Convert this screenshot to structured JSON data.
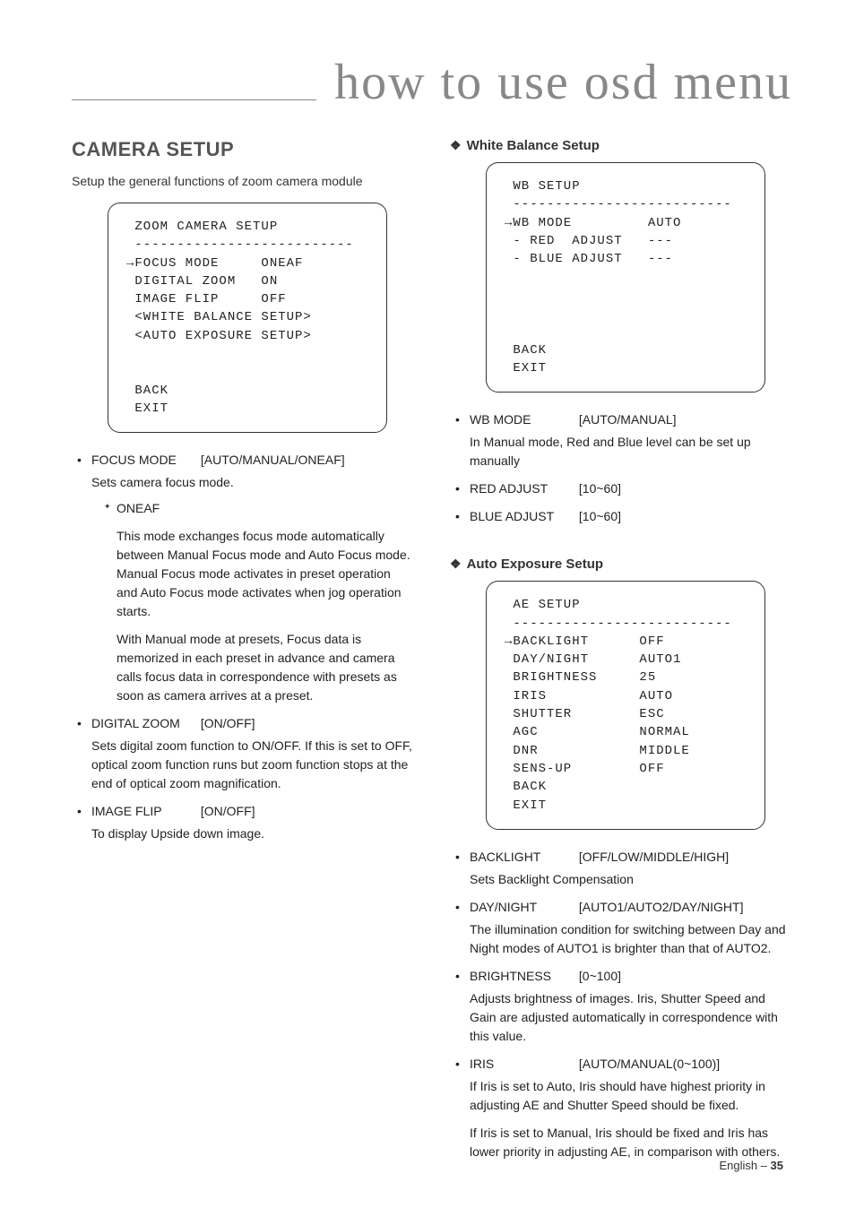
{
  "header": {
    "title": "how to use osd menu"
  },
  "left": {
    "heading": "CAMERA SETUP",
    "intro": "Setup the general functions of zoom camera module",
    "osd": " ZOOM CAMERA SETUP\n --------------------------\n→FOCUS MODE     ONEAF\n DIGITAL ZOOM   ON\n IMAGE FLIP     OFF\n <WHITE BALANCE SETUP>\n <AUTO EXPOSURE SETUP>\n\n\n BACK\n EXIT",
    "items": [
      {
        "label": "FOCUS MODE",
        "range": "[AUTO/MANUAL/ONEAF]",
        "desc": "Sets camera focus mode.",
        "sub": {
          "label": "ONEAF",
          "p1": "This mode exchanges focus mode automatically between Manual Focus mode and Auto Focus mode. Manual Focus mode activates in preset operation and Auto Focus mode activates when jog operation starts.",
          "p2": "With Manual mode at presets, Focus data is memorized in each preset in advance and camera calls focus data in correspondence with presets as soon as camera arrives at a preset."
        }
      },
      {
        "label": "DIGITAL ZOOM",
        "range": "[ON/OFF]",
        "desc": "Sets digital zoom function to ON/OFF. If this is set to OFF, optical zoom function runs but zoom function stops at the end of optical zoom magnification."
      },
      {
        "label": "IMAGE FLIP",
        "range": "[ON/OFF]",
        "desc": "To display Upside down image."
      }
    ]
  },
  "right": {
    "wb": {
      "heading": "White Balance Setup",
      "osd": " WB SETUP\n --------------------------\n→WB MODE         AUTO\n - RED  ADJUST   ---\n - BLUE ADJUST   ---\n\n\n\n\n BACK\n EXIT",
      "items": [
        {
          "label": "WB MODE",
          "range": "[AUTO/MANUAL]",
          "desc": "In Manual mode, Red and Blue level can be set up manually"
        },
        {
          "label": "RED ADJUST",
          "range": "[10~60]"
        },
        {
          "label": "BLUE ADJUST",
          "range": "[10~60]"
        }
      ]
    },
    "ae": {
      "heading": "Auto Exposure Setup",
      "osd": " AE SETUP\n --------------------------\n→BACKLIGHT      OFF\n DAY/NIGHT      AUTO1\n BRIGHTNESS     25\n IRIS           AUTO\n SHUTTER        ESC\n AGC            NORMAL\n DNR            MIDDLE\n SENS-UP        OFF\n BACK\n EXIT",
      "items": [
        {
          "label": "BACKLIGHT",
          "range": "[OFF/LOW/MIDDLE/HIGH]",
          "desc": "Sets Backlight Compensation"
        },
        {
          "label": "DAY/NIGHT",
          "range": "[AUTO1/AUTO2/DAY/NIGHT]",
          "desc": "The illumination condition for switching between Day and Night modes of AUTO1 is brighter than that of AUTO2."
        },
        {
          "label": "BRIGHTNESS",
          "range": "[0~100]",
          "desc": "Adjusts brightness of images. Iris, Shutter Speed and Gain are adjusted automatically in correspondence with this value."
        },
        {
          "label": "IRIS",
          "range": "[AUTO/MANUAL(0~100)]",
          "desc": "If Iris is set to Auto, Iris should have highest priority in adjusting AE and Shutter Speed should be fixed.",
          "desc2": "If Iris is set to Manual, Iris should be fixed and Iris has lower priority in adjusting AE, in comparison with others."
        }
      ]
    }
  },
  "footer": {
    "lang": "English – ",
    "page": "35"
  }
}
